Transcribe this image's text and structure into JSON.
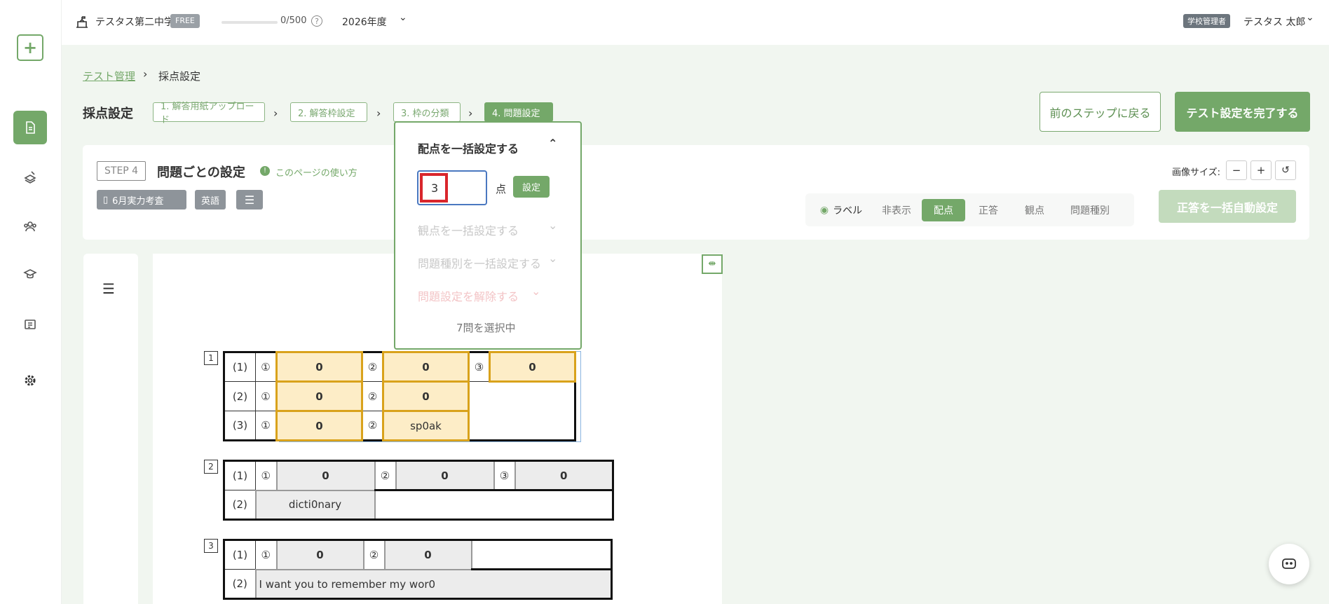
{
  "header": {
    "school": "テスタス第二中学",
    "plan_badge": "FREE",
    "usage": "0/500",
    "year": "2026年度",
    "role": "学校管理者",
    "user": "テスタス 太郎"
  },
  "breadcrumb": {
    "parent": "テスト管理",
    "current": "採点設定"
  },
  "page": {
    "title": "採点設定",
    "steps": [
      "1. 解答用紙アップロード",
      "2. 解答枠設定",
      "3. 枠の分類",
      "4. 問題設定"
    ],
    "back_button": "前のステップに戻る",
    "finish_button": "テスト設定を完了する"
  },
  "card": {
    "step_badge": "STEP 4",
    "title": "問題ごとの設定",
    "help_link": "このページの使い方",
    "tags": [
      "6月実力考査",
      "英語"
    ],
    "image_size_label": "画像サイズ:",
    "zoom_out": "−",
    "zoom_in": "+",
    "toggle": [
      "ラベル",
      "非表示",
      "配点",
      "正答",
      "観点",
      "問題種別"
    ],
    "auto_button": "正答を一括自動設定"
  },
  "popover": {
    "title": "配点を一括設定する",
    "input_value": "3",
    "unit": "点",
    "set_button": "設定",
    "viewpoint_label": "観点を一括設定する",
    "qtype_label": "問題種別を一括設定する",
    "clear_label": "問題設定を解除する",
    "selected_count": "7問を選択中"
  },
  "answer_sheet": {
    "q1": {
      "no": "1",
      "rows": [
        {
          "label": "(1)",
          "cells": [
            {
              "n": "①",
              "v": "0"
            },
            {
              "n": "②",
              "v": "0"
            },
            {
              "n": "③",
              "v": "0"
            }
          ]
        },
        {
          "label": "(2)",
          "cells": [
            {
              "n": "①",
              "v": "0"
            },
            {
              "n": "②",
              "v": "0"
            }
          ]
        },
        {
          "label": "(3)",
          "cells": [
            {
              "n": "①",
              "v": "0"
            },
            {
              "n": "②",
              "v": "sp0ak"
            }
          ]
        }
      ]
    },
    "q2": {
      "no": "2",
      "rows": [
        {
          "label": "(1)",
          "cells": [
            {
              "n": "①",
              "v": "0"
            },
            {
              "n": "②",
              "v": "0"
            },
            {
              "n": "③",
              "v": "0"
            }
          ]
        },
        {
          "label": "(2)",
          "cells": [
            {
              "v": "dicti0nary"
            }
          ]
        }
      ]
    },
    "q3": {
      "no": "3",
      "rows": [
        {
          "label": "(1)",
          "cells": [
            {
              "n": "①",
              "v": "0"
            },
            {
              "n": "②",
              "v": "0"
            }
          ]
        },
        {
          "label": "(2)",
          "cells": [
            {
              "v": "I want you to remember my wor0"
            }
          ]
        }
      ]
    }
  },
  "colors": {
    "accent": "#74a869",
    "selected_cell": "#fdedc7",
    "selected_border": "#d9a21b",
    "highlight_input": "#d9262c"
  }
}
